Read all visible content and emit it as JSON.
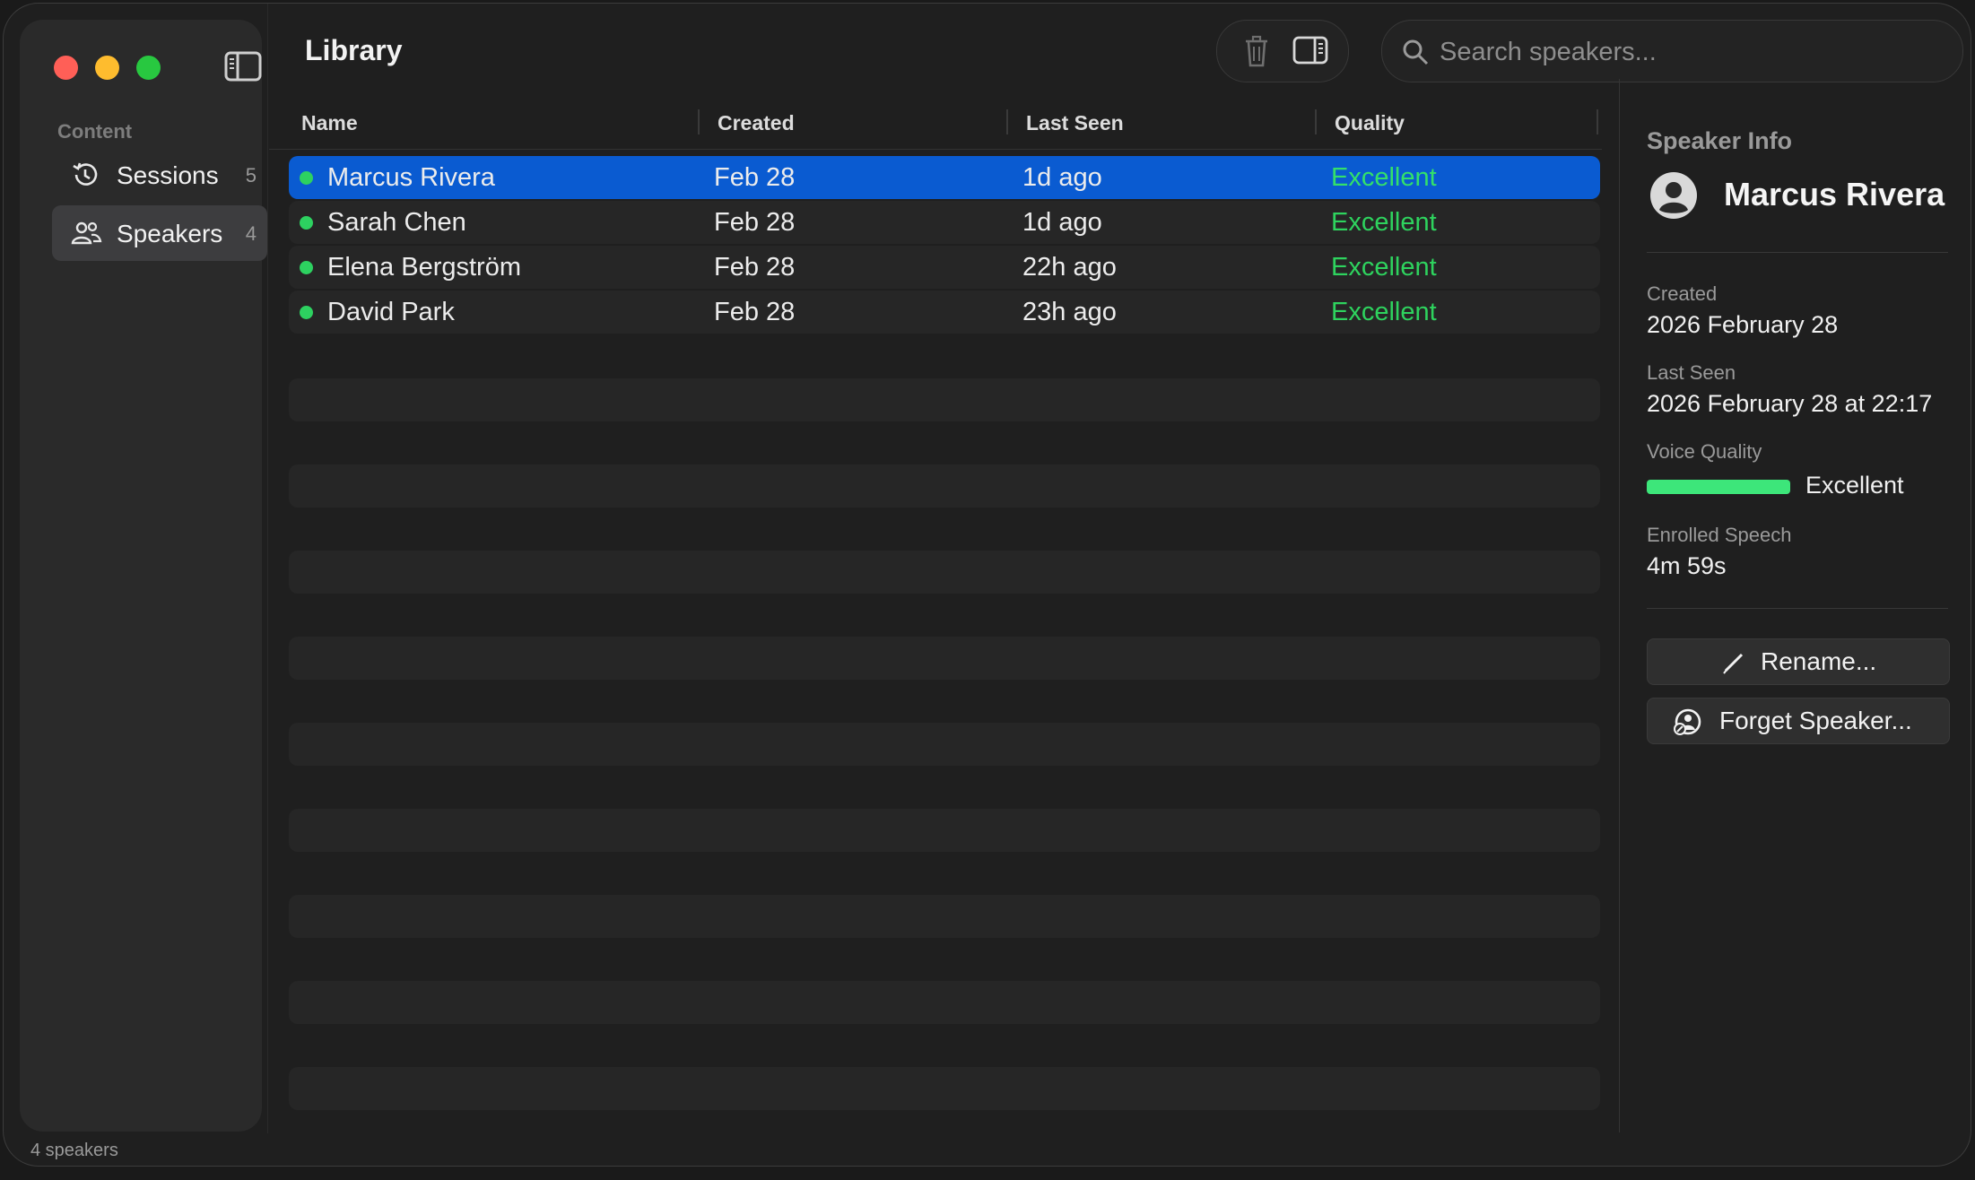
{
  "sidebar": {
    "section_header": "Content",
    "items": [
      {
        "label": "Sessions",
        "count": "5",
        "icon": "history-icon"
      },
      {
        "label": "Speakers",
        "count": "4",
        "icon": "people-icon",
        "active": true
      }
    ]
  },
  "header": {
    "title": "Library",
    "toolbar": {
      "delete_icon": "trash-icon",
      "inspector_toggle_icon": "sidebar-right-icon"
    }
  },
  "search": {
    "placeholder": "Search speakers..."
  },
  "table": {
    "columns": [
      "Name",
      "Created",
      "Last Seen",
      "Quality"
    ],
    "rows": [
      {
        "name": "Marcus Rivera",
        "created": "Feb 28",
        "last_seen": "1d ago",
        "quality": "Excellent",
        "selected": true
      },
      {
        "name": "Sarah Chen",
        "created": "Feb 28",
        "last_seen": "1d ago",
        "quality": "Excellent"
      },
      {
        "name": "Elena Bergström",
        "created": "Feb 28",
        "last_seen": "22h ago",
        "quality": "Excellent"
      },
      {
        "name": "David Park",
        "created": "Feb 28",
        "last_seen": "23h ago",
        "quality": "Excellent"
      }
    ]
  },
  "inspector": {
    "title": "Speaker Info",
    "name": "Marcus Rivera",
    "created_label": "Created",
    "created_value": "2026 February 28",
    "last_seen_label": "Last Seen",
    "last_seen_value": "2026 February 28 at 22:17",
    "voice_quality_label": "Voice Quality",
    "voice_quality_value": "Excellent",
    "voice_quality_level": 1.0,
    "enrolled_label": "Enrolled Speech",
    "enrolled_value": "4m 59s",
    "rename_label": "Rename...",
    "forget_label": "Forget Speaker..."
  },
  "status_bar": {
    "text": "4 speakers"
  },
  "colors": {
    "accent": "#0a5bd1",
    "quality_green": "#2ed35e",
    "status_dot": "#2dd160",
    "close": "#ff5f57",
    "minimize": "#febc2e",
    "maximize": "#28c840"
  }
}
